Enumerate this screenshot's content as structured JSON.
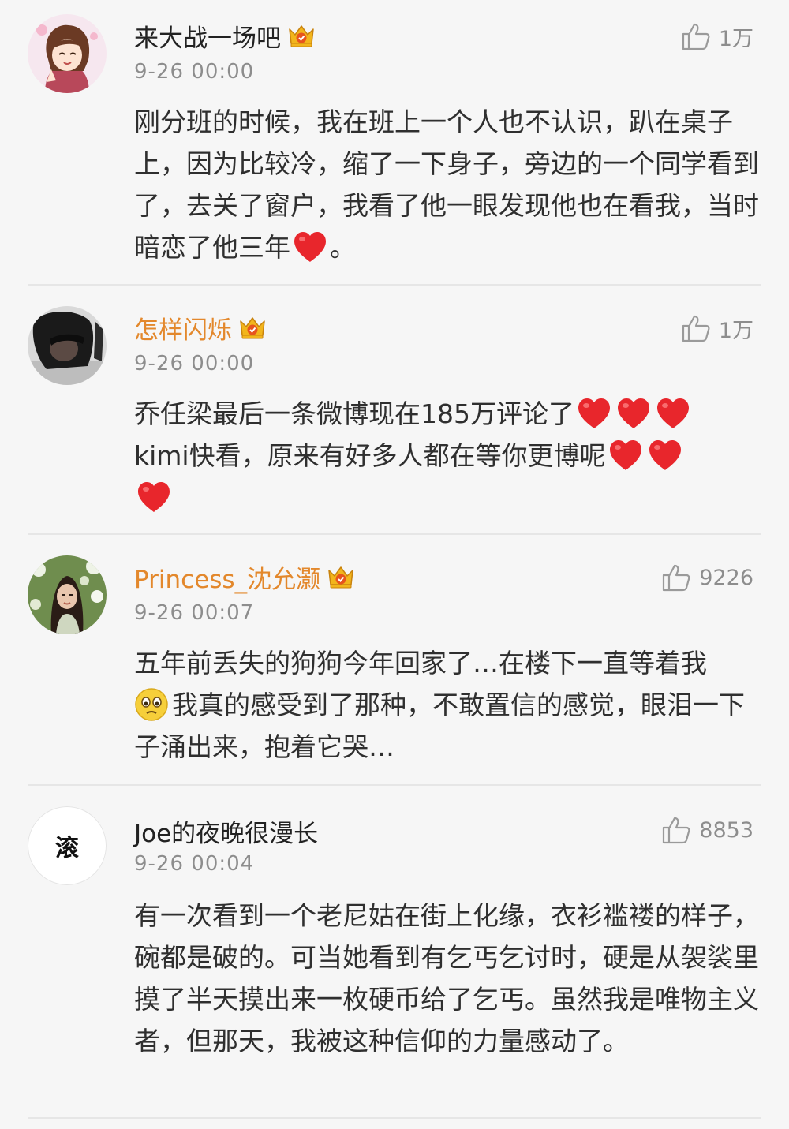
{
  "comments": [
    {
      "avatar": "anime-girl-avatar",
      "username": "来大战一场吧",
      "time": "9-26 00:00",
      "likes": "1万",
      "verified": true,
      "text": "刚分班的时候，我在班上一个人也不认识，趴在桌子上，因为比较冷，缩了一下身子，旁边的一个同学看到了，去关了窗户，我看了他一眼发现他也在看我，当时暗恋了他三年",
      "text_end": "。"
    },
    {
      "avatar": "dark-photo-avatar",
      "username": "怎样闪烁",
      "time": "9-26 00:00",
      "likes": "1万",
      "verified": true,
      "line1": "乔任梁最后一条微博现在185万评论了",
      "line2": "kimi快看，原来有好多人都在等你更博呢"
    },
    {
      "avatar": "girl-flowers-avatar",
      "username": "Princess_沈允灏",
      "time": "9-26 00:07",
      "likes": "9226",
      "verified": true,
      "line1": "五年前丢失的狗狗今年回家了…在楼下一直等着我",
      "line2": "我真的感受到了那种，不敢置信的感觉，眼泪一下子涌出来，抱着它哭…"
    },
    {
      "avatar_text": "滚",
      "username": "Joe的夜晚很漫长",
      "time": "9-26 00:04",
      "likes": "8853",
      "verified": false,
      "text": "有一次看到一个老尼姑在街上化缘，衣衫褴褛的样子，碗都是破的。可当她看到有乞丐乞讨时，硬是从袈裟里摸了半天摸出来一枚硬币给了乞丐。虽然我是唯物主义者，但那天，我被这种信仰的力量感动了。"
    }
  ],
  "colors": {
    "vip_name": "#e3882c",
    "heart": "#e8262c",
    "background": "#f6f6f6"
  }
}
